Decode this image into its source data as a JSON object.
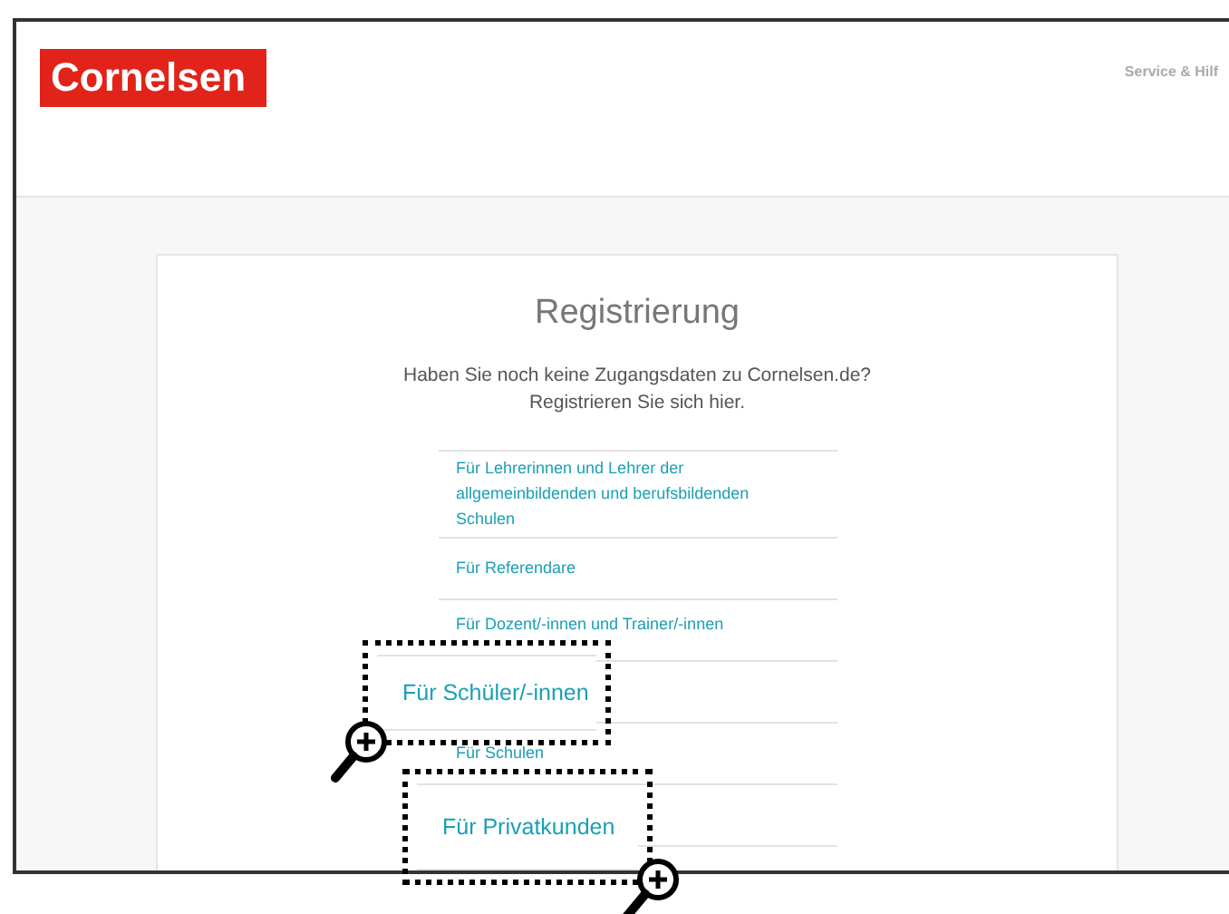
{
  "header": {
    "logo": "Cornelsen",
    "service_link": "Service & Hilf"
  },
  "card": {
    "title": "Registrierung",
    "intro": [
      "Haben Sie noch keine Zugangsdaten zu Cornelsen.de?",
      "Registrieren Sie sich hier."
    ],
    "options": [
      {
        "label": "Für Lehrerinnen und Lehrer der allgemeinbildenden und berufsbildenden Schulen",
        "magnified": false
      },
      {
        "label": "Für Referendare",
        "magnified": false
      },
      {
        "label": "Für Dozent/-innen und Trainer/-innen",
        "magnified": false
      },
      {
        "label": "Für Schüler/-innen",
        "magnified": true
      },
      {
        "label": "Für Schulen",
        "magnified": false
      },
      {
        "label": "Für Privatkunden",
        "magnified": true
      }
    ]
  }
}
